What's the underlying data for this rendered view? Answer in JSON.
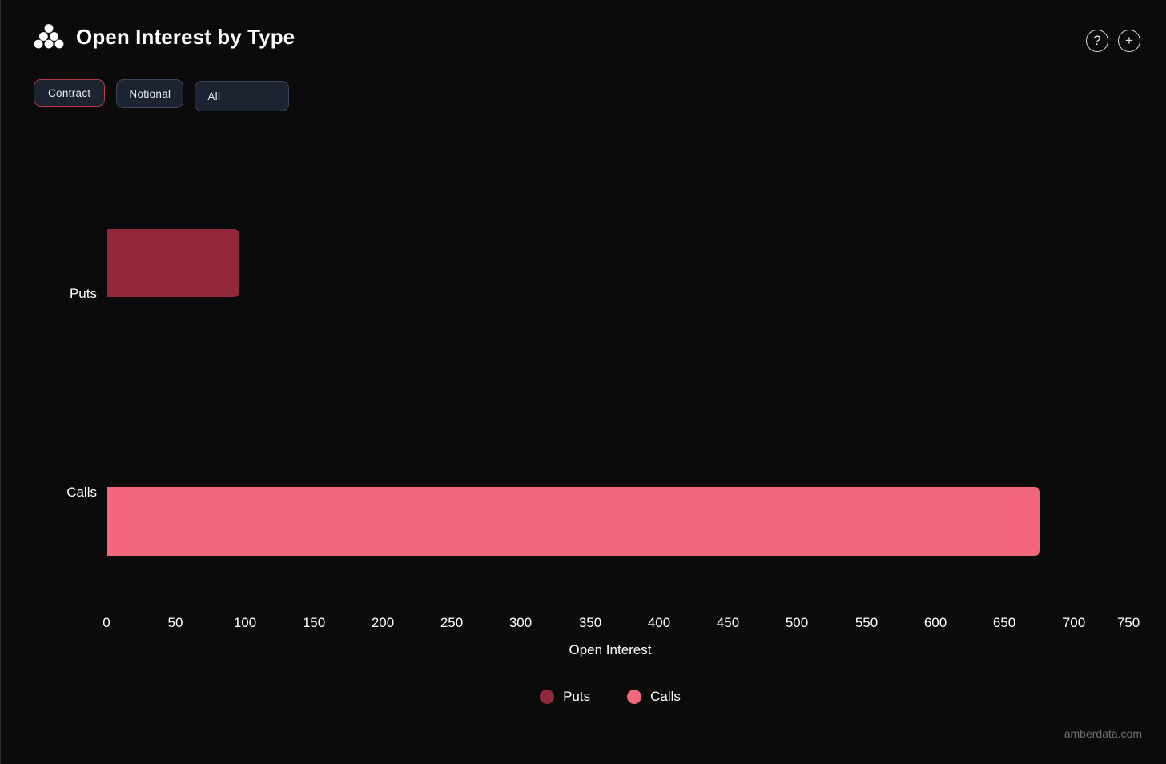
{
  "header": {
    "title": "Open Interest by Type",
    "logo_icon": "amberdata-pyramid-logo",
    "help_icon_glyph": "?",
    "add_icon_glyph": "+"
  },
  "toggles": [
    {
      "label": "Contract",
      "selected": true
    },
    {
      "label": "Notional",
      "selected": false
    },
    {
      "label": "All",
      "selected": false
    }
  ],
  "colors": {
    "background": "#0b0b0c",
    "puts": "#92293b",
    "calls": "#f3677d",
    "selected_border": "#b03a4c",
    "button_bg": "#1c2331",
    "button_border": "#39465c",
    "axis_line": "#4a4a4f",
    "text": "#ffffff",
    "watermark": "#6e6e76"
  },
  "chart_data": {
    "type": "bar",
    "orientation": "horizontal",
    "title": "Open Interest by Type",
    "categories": [
      "Puts",
      "Calls"
    ],
    "values": [
      96,
      674
    ],
    "series": [
      {
        "name": "Puts",
        "values": [
          96
        ],
        "color": "#92293b"
      },
      {
        "name": "Calls",
        "values": [
          674
        ],
        "color": "#f3677d"
      }
    ],
    "xlabel": "Open Interest",
    "ylabel": "",
    "xlim": [
      0,
      750
    ],
    "xticks": [
      0,
      50,
      100,
      150,
      200,
      250,
      300,
      350,
      400,
      450,
      500,
      550,
      600,
      650,
      700,
      750
    ],
    "xtick_labels": [
      "0",
      "50",
      "100",
      "150",
      "200",
      "250",
      "300",
      "350",
      "400",
      "450",
      "500",
      "550",
      "600",
      "650",
      "700",
      "750"
    ],
    "grid": false,
    "legend": [
      {
        "label": "Puts",
        "color": "#92293b"
      },
      {
        "label": "Calls",
        "color": "#f3677d"
      }
    ],
    "legend_position": "bottom"
  },
  "footer": {
    "watermark": "amberdata.com"
  }
}
